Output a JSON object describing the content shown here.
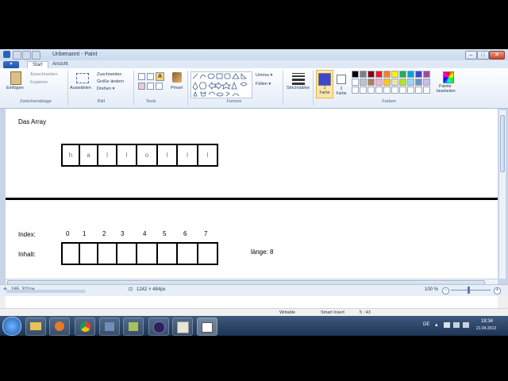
{
  "window": {
    "title": "Unbenannt - Paint",
    "controls": {
      "minimize": "–",
      "maximize": "□",
      "close": "✕"
    }
  },
  "tabs": {
    "file": "▾",
    "start": "Start",
    "view": "Ansicht"
  },
  "ribbon": {
    "clipboard": {
      "paste": "Einfügen",
      "cut": "Ausschneiden",
      "copy": "Kopieren",
      "label": "Zwischenablage"
    },
    "image": {
      "select": "Auswählen",
      "crop": "Zuschneiden",
      "resize": "Größe ändern",
      "rotate": "Drehen ▾",
      "label": "Bild"
    },
    "tools": {
      "label": "Tools",
      "text_glyph": "A"
    },
    "brushes": {
      "label": "Pinsel"
    },
    "shapes": {
      "outline": "Umriss ▾",
      "fill": "Füllen ▾",
      "label": "Formen"
    },
    "stroke": {
      "label": "Strichstärke"
    },
    "color1": {
      "num": "1",
      "label": "Farbe"
    },
    "color2": {
      "num": "2",
      "label": "Farbe"
    },
    "colors": {
      "label": "Farben",
      "edit_line1": "Palette",
      "edit_line2": "bearbeiten",
      "row1": [
        "#000000",
        "#7f7f7f",
        "#880015",
        "#ed1c24",
        "#ff7f27",
        "#fff200",
        "#22b14c",
        "#00a2e8",
        "#3f48cc",
        "#a349a4"
      ],
      "row2": [
        "#ffffff",
        "#c3c3c3",
        "#b97a57",
        "#ffaec9",
        "#ffc90e",
        "#efe4b0",
        "#b5e61d",
        "#99d9ea",
        "#7092be",
        "#c8bfe7"
      ]
    },
    "accent": "#3f48cc"
  },
  "canvas": {
    "heading": "Das Array",
    "array_chars": [
      "h",
      "a",
      "l",
      "l",
      "o",
      "l",
      "l",
      "l"
    ],
    "index_label": "Index:",
    "content_label": "Inhalt:",
    "indices": [
      "0",
      "1",
      "2",
      "3",
      "4",
      "5",
      "6",
      "7"
    ],
    "length_text": "länge: 8"
  },
  "status": {
    "cursor_pos": "165, 321px",
    "canvas_size": "1242 × 484px",
    "zoom": "100 %"
  },
  "strip2": {
    "mode": "Writable",
    "insert": "Smart Insert",
    "pos": "5 : 43"
  },
  "taskbar": {
    "lang": "DE",
    "time": "18:34",
    "date": "21.04.2013"
  }
}
